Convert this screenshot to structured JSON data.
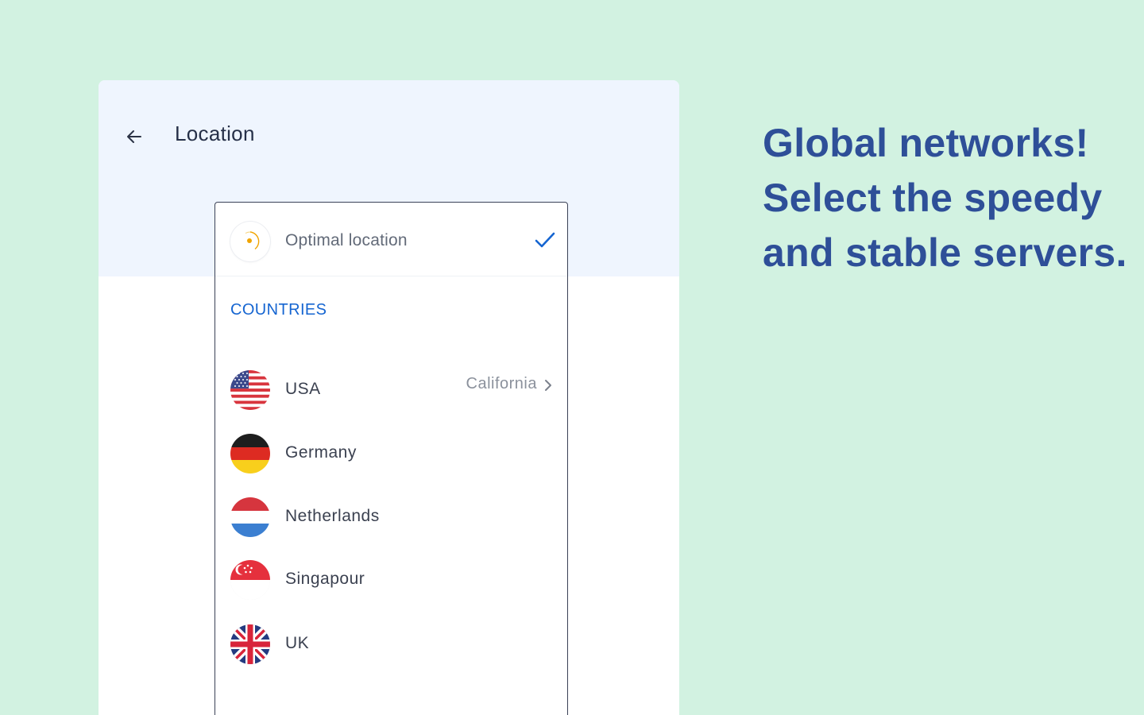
{
  "header": {
    "title": "Location"
  },
  "optimal": {
    "label": "Optimal location",
    "selected": true
  },
  "countries": {
    "section_title": "COUNTRIES",
    "items": [
      {
        "name": "USA",
        "region": "California",
        "flag": "us-flag-icon"
      },
      {
        "name": "Germany",
        "flag": "de-flag-icon"
      },
      {
        "name": "Netherlands",
        "flag": "nl-flag-icon"
      },
      {
        "name": "Singapour",
        "flag": "sg-flag-icon"
      },
      {
        "name": "UK",
        "flag": "uk-flag-icon"
      }
    ]
  },
  "tagline": {
    "line1": "Global networks!",
    "line2": "Select the speedy",
    "line3": "and stable servers."
  },
  "colors": {
    "background": "#d2f2e1",
    "header_bg": "#eff5fe",
    "accent_blue": "#1565d1",
    "tagline": "#2e4f98",
    "optimal_icon": "#f0a400"
  }
}
